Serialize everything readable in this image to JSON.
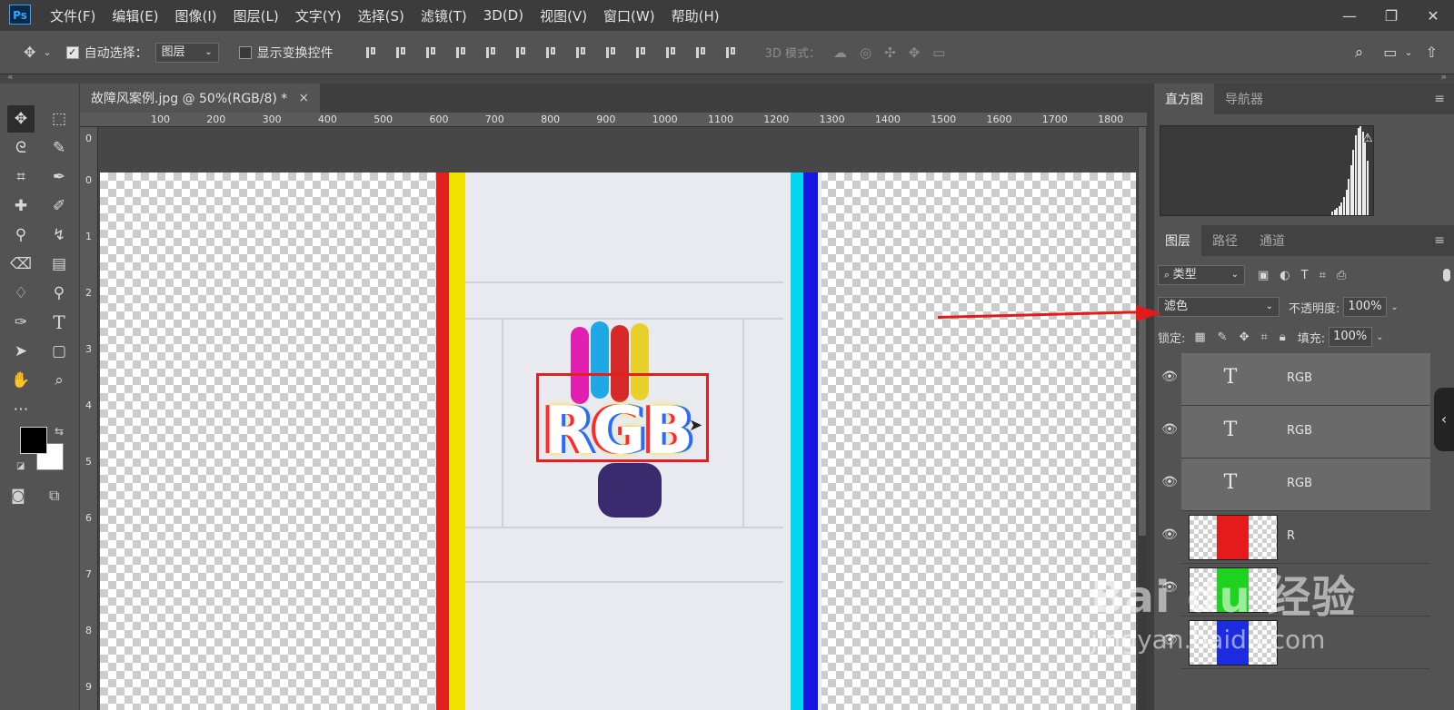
{
  "app": {
    "logo": "Ps"
  },
  "menu": [
    "文件(F)",
    "编辑(E)",
    "图像(I)",
    "图层(L)",
    "文字(Y)",
    "选择(S)",
    "滤镜(T)",
    "3D(D)",
    "视图(V)",
    "窗口(W)",
    "帮助(H)"
  ],
  "window_controls": {
    "minimize": "—",
    "restore": "❐",
    "close": "✕"
  },
  "options": {
    "move_tool_icon": "move-icon",
    "auto_select_label": "自动选择：",
    "auto_select_checked": true,
    "auto_select_target": "图层",
    "show_transform_label": "显示变换控件",
    "show_transform_checked": false,
    "mode_3d_label": "3D 模式："
  },
  "document": {
    "tab_title": "故障风案例.jpg @ 50%(RGB/8) *",
    "close_glyph": "×",
    "ruler_h": [
      "100",
      "200",
      "300",
      "400",
      "500",
      "600",
      "700",
      "800",
      "900",
      "1000",
      "1100",
      "1200",
      "1300",
      "1400",
      "1500",
      "1600",
      "1700",
      "1800"
    ],
    "ruler_v": [
      "0",
      "0",
      "1",
      "2",
      "3",
      "4",
      "5",
      "6",
      "7",
      "8",
      "9"
    ],
    "canvas_text": "RGB"
  },
  "histogram_panel": {
    "tabs": [
      "直方图",
      "导航器"
    ]
  },
  "layers_panel": {
    "tabs": [
      "图层",
      "路径",
      "通道"
    ],
    "filter_label": "类型",
    "blend_mode": "滤色",
    "opacity_label": "不透明度:",
    "opacity_value": "100%",
    "lock_label": "锁定:",
    "fill_label": "填充:",
    "fill_value": "100%",
    "layers": [
      {
        "name": "RGB",
        "kind": "text"
      },
      {
        "name": "RGB",
        "kind": "text"
      },
      {
        "name": "RGB",
        "kind": "text"
      },
      {
        "name": "R",
        "kind": "image",
        "color": "#e51b1b"
      },
      {
        "name": "",
        "kind": "image",
        "color": "#1fd21f"
      },
      {
        "name": "",
        "kind": "image",
        "color": "#1a2be0"
      }
    ]
  },
  "watermark": {
    "logo": "Bai du 经验",
    "url": "jingyan.baidu.com"
  },
  "colors": {
    "red": "#e31f1f",
    "yellow": "#f2e200",
    "cyan": "#00d8f0",
    "blue": "#1418e0"
  }
}
